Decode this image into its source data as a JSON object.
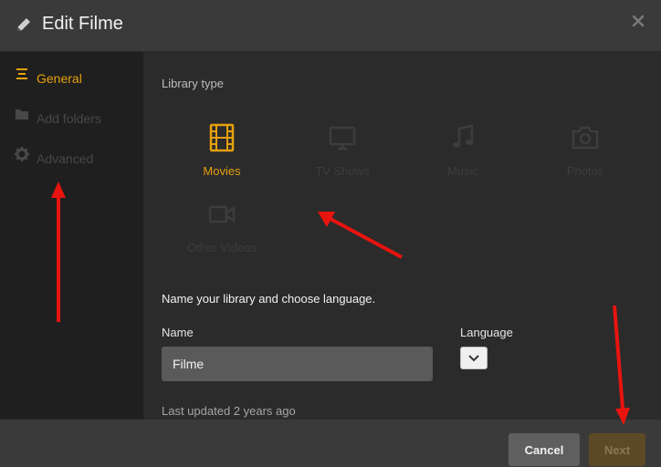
{
  "dialog": {
    "title": "Edit Filme"
  },
  "sidebar": {
    "items": [
      {
        "label": "General",
        "icon": "list-icon",
        "active": true
      },
      {
        "label": "Add folders",
        "icon": "folder-icon",
        "active": false
      },
      {
        "label": "Advanced",
        "icon": "gear-icon",
        "active": false
      }
    ]
  },
  "main": {
    "library_type_label": "Library type",
    "types": [
      {
        "label": "Movies",
        "icon": "film-icon",
        "selected": true
      },
      {
        "label": "TV Shows",
        "icon": "tv-icon",
        "selected": false
      },
      {
        "label": "Music",
        "icon": "music-note-icon",
        "selected": false
      },
      {
        "label": "Photos",
        "icon": "camera-icon",
        "selected": false
      },
      {
        "label": "Other Videos",
        "icon": "video-camera-icon",
        "selected": false
      }
    ],
    "instructions": "Name your library and choose language.",
    "name_label": "Name",
    "name_value": "Filme",
    "language_label": "Language",
    "language_value": "",
    "last_updated": "Last updated 2 years ago"
  },
  "footer": {
    "cancel_label": "Cancel",
    "next_label": "Next"
  },
  "colors": {
    "accent": "#e5a00d",
    "annotation_arrow": "#e8140f"
  }
}
